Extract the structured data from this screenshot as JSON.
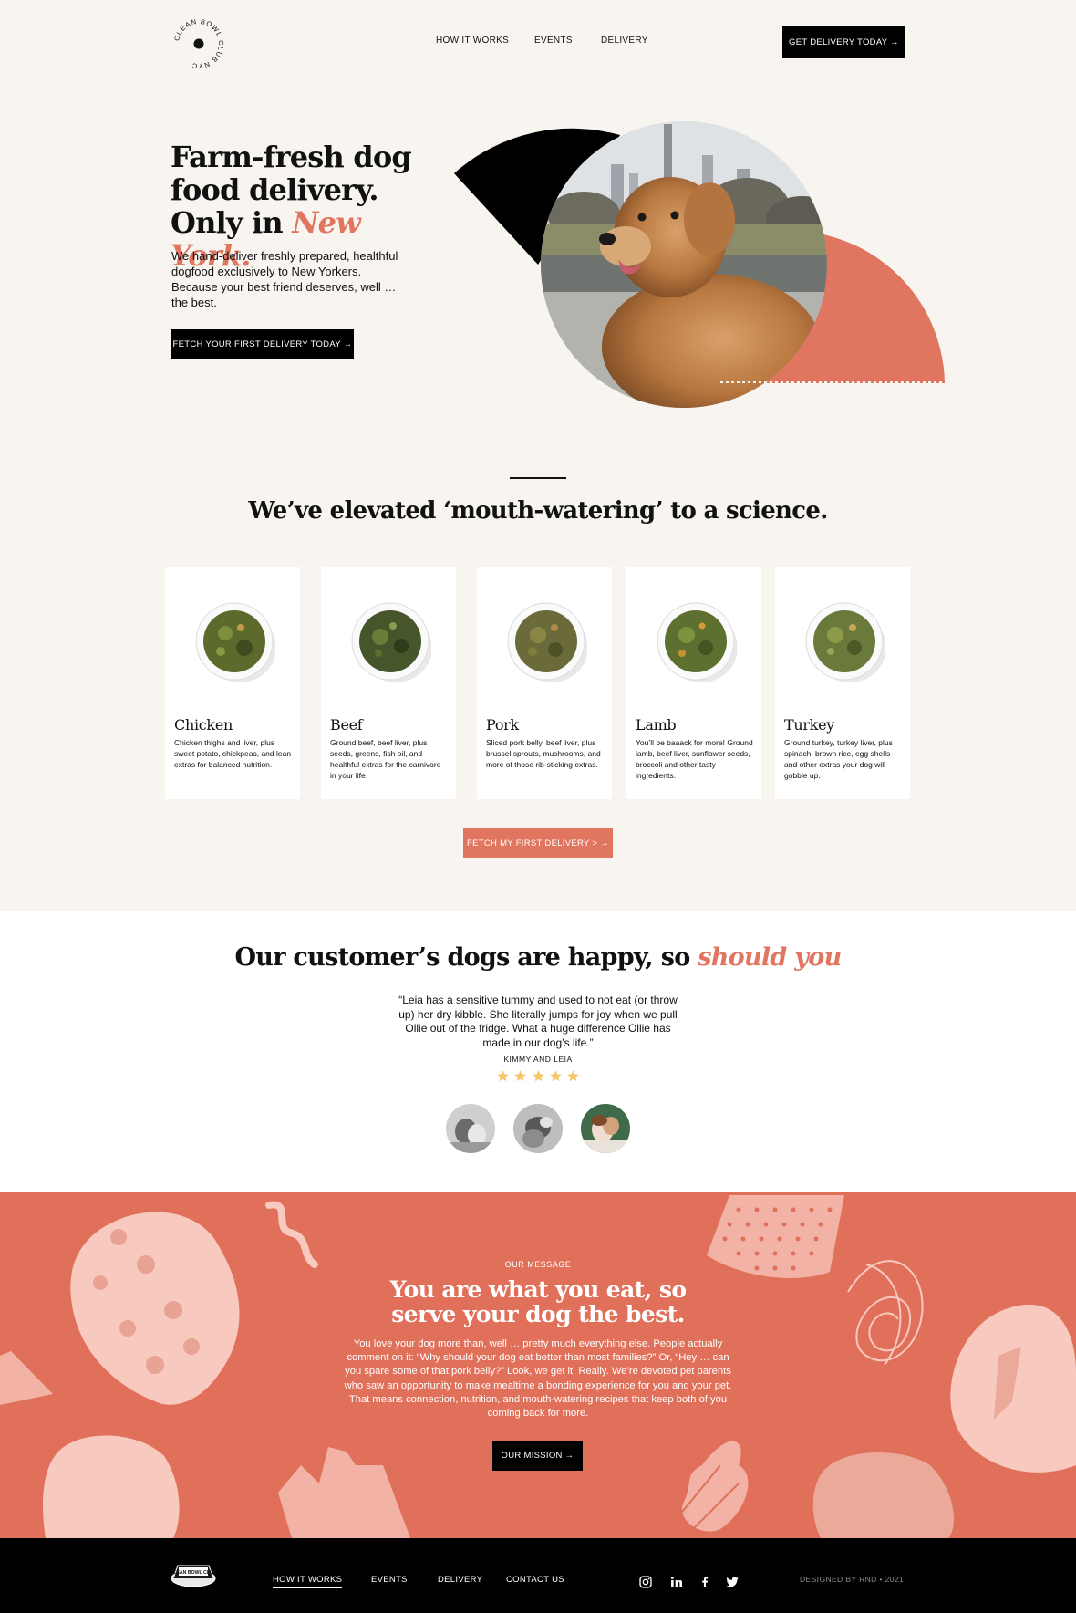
{
  "brand": {
    "logo_text": "CLEAN BOWL CLUB NYC"
  },
  "nav": {
    "how_it_works": "HOW IT WORKS",
    "events": "EVENTS",
    "delivery": "DELIVERY",
    "cta": "GET DELIVERY TODAY →"
  },
  "hero": {
    "title_line1": "Farm-fresh dog",
    "title_line2": "food delivery.",
    "title_line3_prefix": "Only in ",
    "title_accent": "New York.",
    "text": "We hand-deliver freshly prepared, healthful dogfood exclusively to New Yorkers. Because your best friend deserves, well … the best.",
    "button": "FETCH YOUR FIRST DELIVERY TODAY →"
  },
  "recipes": {
    "title": "We’ve elevated ‘mouth-watering’ to a science.",
    "items": [
      {
        "name": "Chicken",
        "desc": "Chicken thighs and liver, plus sweet potato, chickpeas, and lean extras for balanced nutrition."
      },
      {
        "name": "Beef",
        "desc": "Ground beef, beef liver, plus seeds, greens, fish oil, and healthful extras for the carnivore in your life."
      },
      {
        "name": "Pork",
        "desc": "Sliced pork belly, beef liver, plus brussel sprouts, mushrooms, and more of those rib-sticking extras."
      },
      {
        "name": "Lamb",
        "desc": "You’ll be baaack for more! Ground lamb, beef liver, sunflower seeds, broccoli and other tasty ingredients."
      },
      {
        "name": "Turkey",
        "desc": "Ground turkey, turkey liver, plus spinach, brown rice, egg shells and other extras your dog will gobble up."
      }
    ],
    "button": "FETCH MY FIRST DELIVERY > →"
  },
  "testimonials": {
    "title_prefix": "Our customer’s dogs are happy, so ",
    "title_accent": "should you",
    "quote": "“Leia has a sensitive tummy and used to not eat (or throw up) her dry kibble. She literally jumps for joy when we pull Ollie out of the fridge. What a huge difference Ollie has made in our dog’s life.”",
    "author": "KIMMY AND LEIA",
    "rating": 5
  },
  "message": {
    "eyebrow": "OUR MESSAGE",
    "title_line1": "You are what you eat, so",
    "title_line2": "serve your dog the best.",
    "text": "You love your dog more than, well … pretty much everything else. People actually comment on it: “Why should your dog eat better than most families?” Or, “Hey … can you spare some of that pork belly?” Look, we get it. Really. We’re devoted pet parents who saw an opportunity to make mealtime a bonding experience for you and your pet. That means connection, nutrition, and mouth-watering recipes that keep both of you coming back for more.",
    "button": "OUR MISSION →"
  },
  "footer": {
    "logo_text": "CLEAN BOWL CLUB",
    "links": [
      "HOW IT WORKS",
      "EVENTS",
      "DELIVERY",
      "CONTACT US"
    ],
    "credit": "DESIGNED BY RND • 2021"
  },
  "colors": {
    "accent": "#e07660",
    "background": "#f8f5f0",
    "dark": "#000000",
    "star": "#f5c76a"
  }
}
